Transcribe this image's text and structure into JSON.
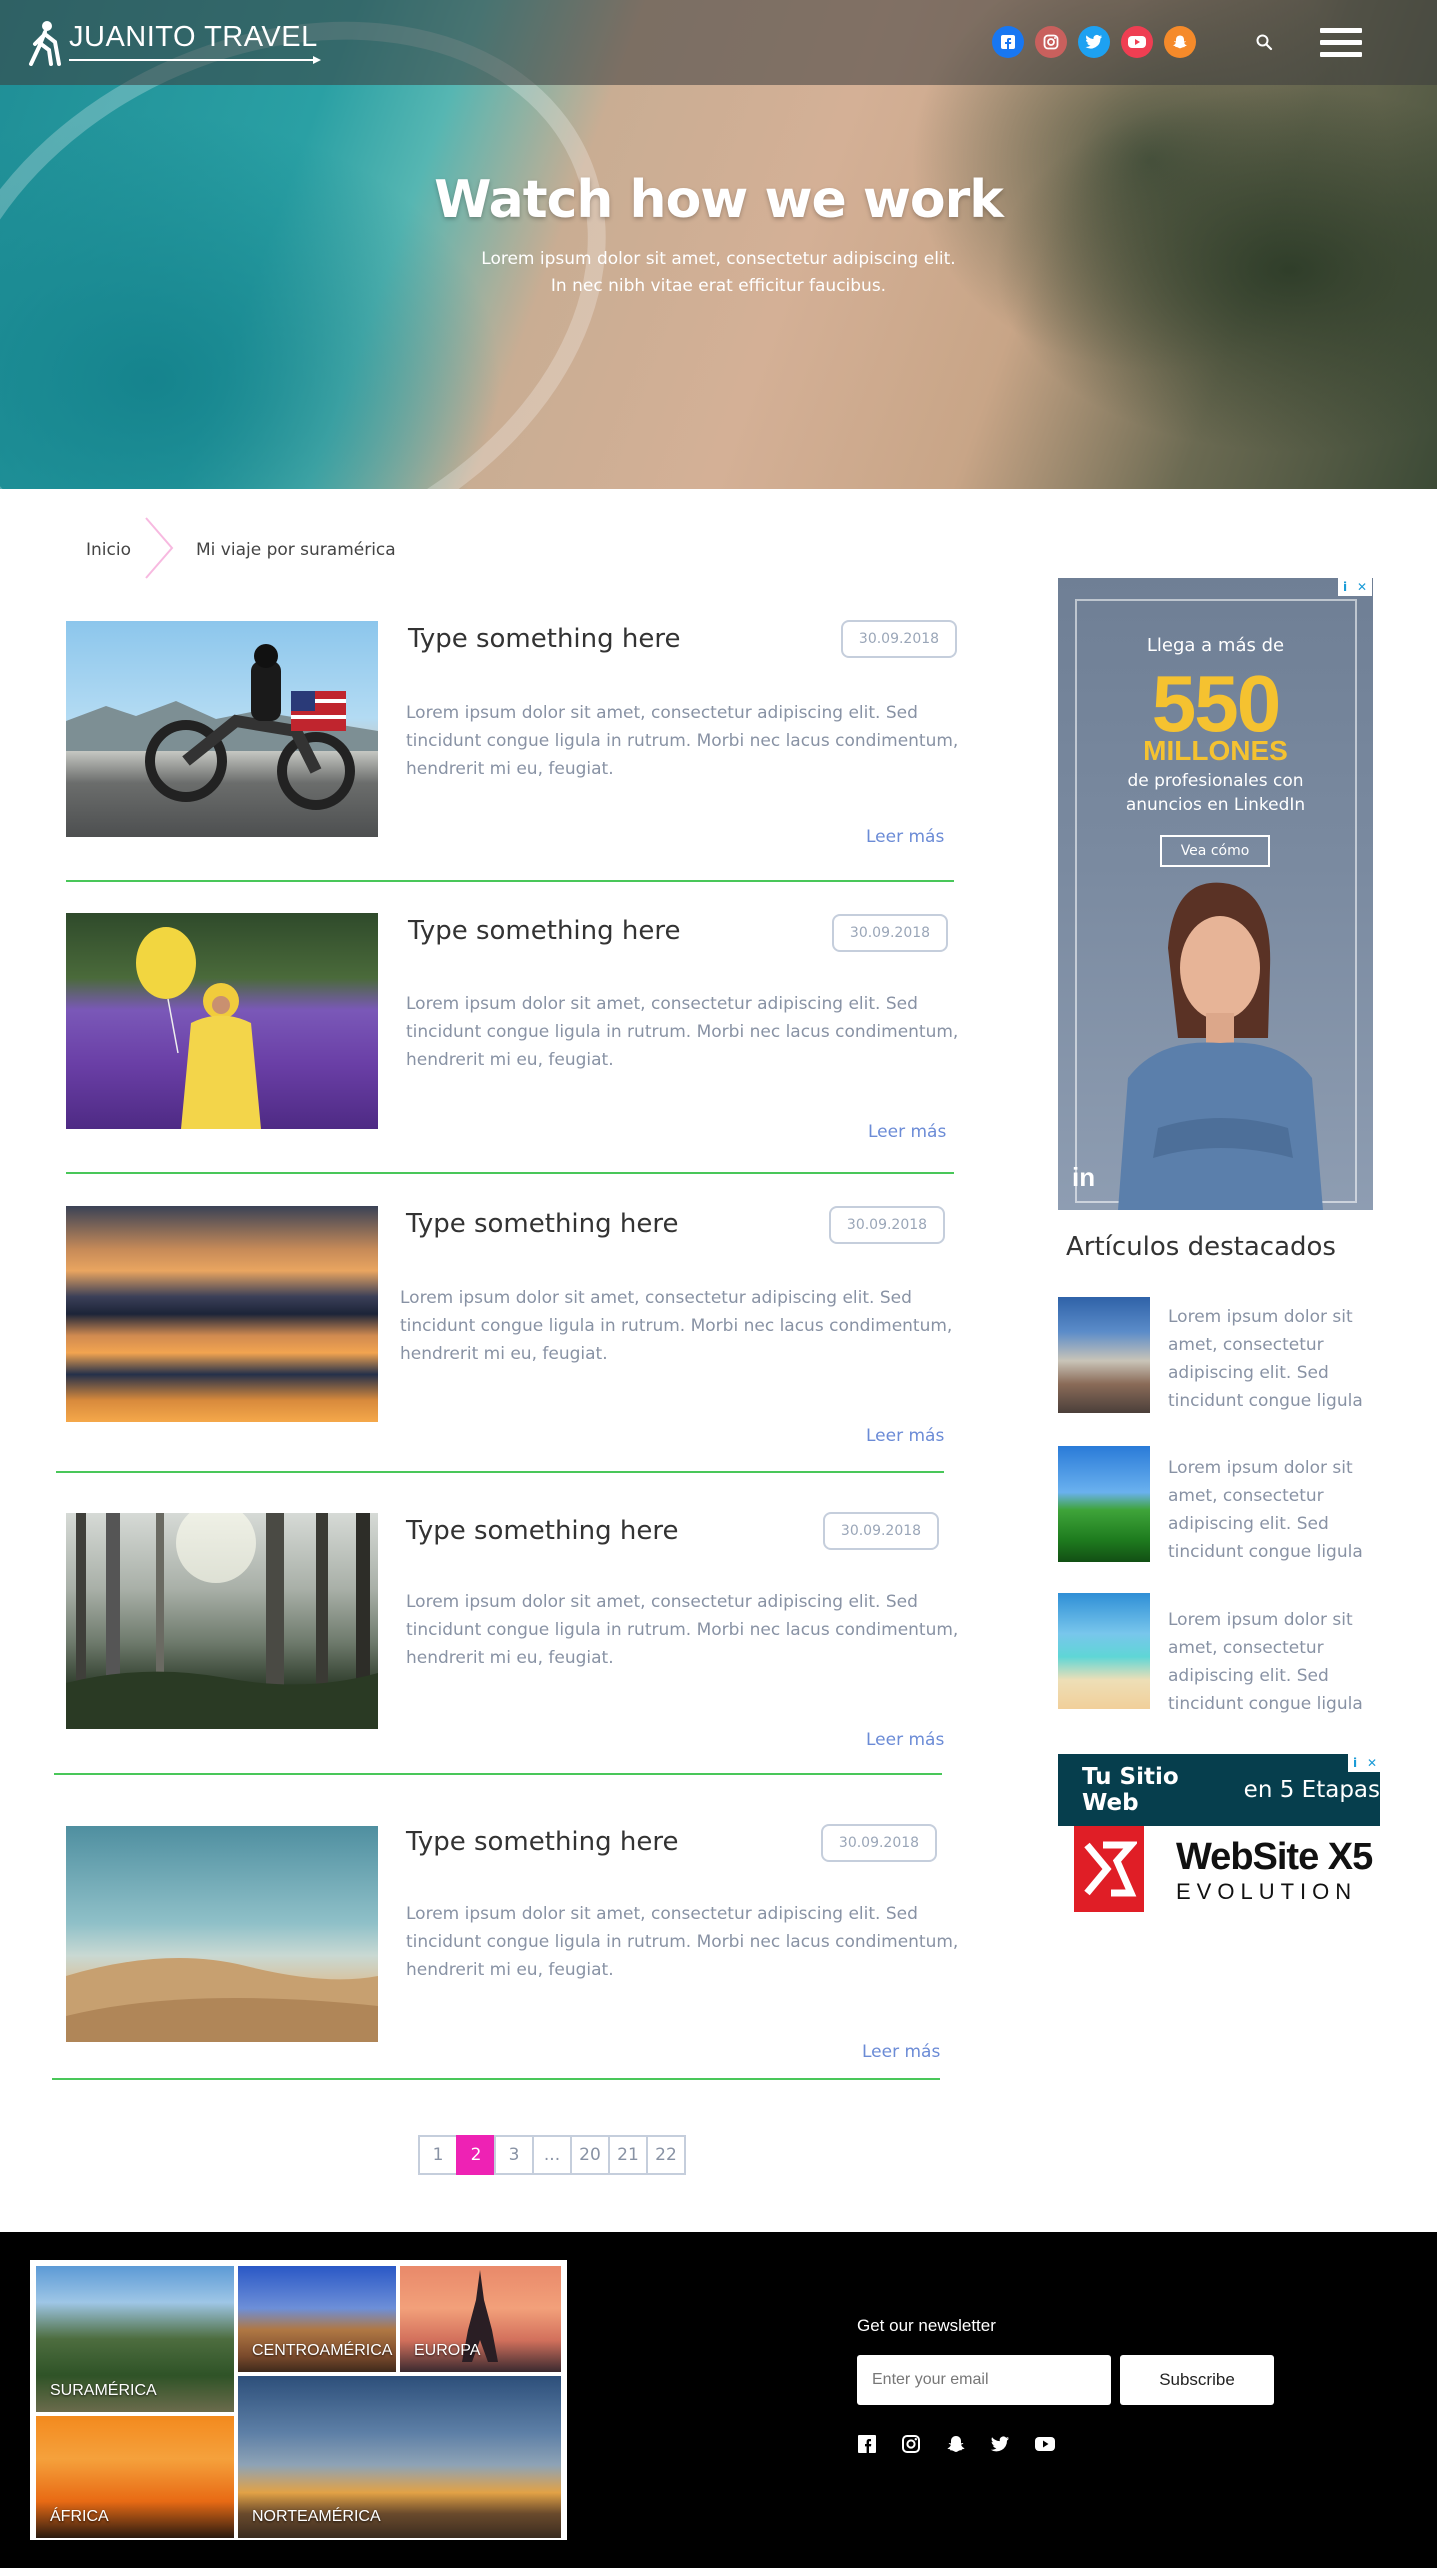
{
  "header": {
    "brand": "JUANITO TRAVEL",
    "social": [
      "facebook-icon",
      "instagram-icon",
      "twitter-icon",
      "youtube-icon",
      "snapchat-icon"
    ],
    "social_colors": [
      "#1877f2",
      "#c9605d",
      "#1da1f2",
      "#ef3e52",
      "#f58a2a"
    ]
  },
  "hero": {
    "title": "Watch how we work",
    "subtitle_line1": "Lorem ipsum dolor sit amet, consectetur adipiscing elit.",
    "subtitle_line2": "In nec nibh vitae erat efficitur faucibus."
  },
  "breadcrumb": {
    "home": "Inicio",
    "current": "Mi viaje por suramérica"
  },
  "articles": [
    {
      "title": "Type something here",
      "date": "30.09.2018",
      "text": "Lorem ipsum dolor sit amet, consectetur adipiscing elit. Sed tincidunt congue ligula in rutrum. Morbi nec lacus condimentum, hendrerit mi eu, feugiat.",
      "more": "Leer más",
      "image": "motorcycle-photo"
    },
    {
      "title": "Type something here",
      "date": "30.09.2018",
      "text": "Lorem ipsum dolor sit amet, consectetur adipiscing elit. Sed tincidunt congue ligula in rutrum. Morbi nec lacus condimentum, hendrerit mi eu, feugiat.",
      "more": "Leer más",
      "image": "lavender-field-photo"
    },
    {
      "title": "Type something here",
      "date": "30.09.2018",
      "text": "Lorem ipsum dolor sit amet, consectetur adipiscing elit. Sed tincidunt congue ligula in rutrum. Morbi nec lacus condimentum, hendrerit mi eu, feugiat.",
      "more": "Leer más",
      "image": "sunset-water-photo"
    },
    {
      "title": "Type something here",
      "date": "30.09.2018",
      "text": "Lorem ipsum dolor sit amet, consectetur adipiscing elit. Sed tincidunt congue ligula in rutrum. Morbi nec lacus condimentum, hendrerit mi eu, feugiat.",
      "more": "Leer más",
      "image": "forest-photo"
    },
    {
      "title": "Type something here",
      "date": "30.09.2018",
      "text": "Lorem ipsum dolor sit amet, consectetur adipiscing elit. Sed tincidunt congue ligula in rutrum. Morbi nec lacus condimentum, hendrerit mi eu, feugiat.",
      "more": "Leer más",
      "image": "desert-dune-photo"
    }
  ],
  "pagination": {
    "pages": [
      "1",
      "2",
      "3",
      "...",
      "20",
      "21",
      "22"
    ],
    "active": "2"
  },
  "sidebar": {
    "ad_linkedin": {
      "line1": "Llega a más de",
      "number": "550",
      "unit": "MILLONES",
      "line2": "de profesionales con",
      "line3": "anuncios en LinkedIn",
      "button": "Vea cómo",
      "logo": "in"
    },
    "featured_title": "Artículos destacados",
    "featured": [
      {
        "text": "Lorem ipsum dolor sit amet, consectetur adipiscing elit. Sed tincidunt congue ligula"
      },
      {
        "text": "Lorem ipsum dolor sit amet, consectetur adipiscing elit. Sed tincidunt congue ligula"
      },
      {
        "text": "Lorem ipsum dolor sit amet, consectetur adipiscing elit. Sed tincidunt congue ligula"
      }
    ],
    "ad_website": {
      "headline_bold": "Tu Sitio Web",
      "headline_rest": " en 5 Etapas",
      "name": "WebSite X5",
      "sub": "EVOLUTION"
    }
  },
  "footer": {
    "regions": [
      "SURAMÉRICA",
      "CENTROAMÉRICA",
      "EUROPA",
      "ÁFRICA",
      "NORTEAMÉRICA"
    ],
    "newsletter_title": "Get our newsletter",
    "email_placeholder": "Enter your email",
    "subscribe": "Subscribe",
    "social": [
      "facebook-icon",
      "instagram-icon",
      "snapchat-icon",
      "twitter-icon",
      "youtube-icon"
    ]
  }
}
